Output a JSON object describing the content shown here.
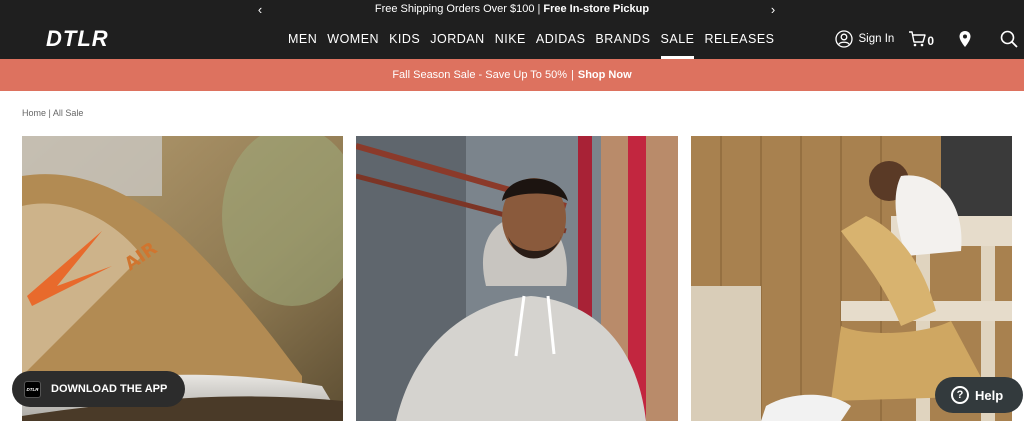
{
  "promo": {
    "text_regular": "Free Shipping Orders Over $100 | ",
    "text_bold": "Free In-store Pickup",
    "prev_glyph": "‹",
    "next_glyph": "›"
  },
  "header": {
    "logo": "DTLR",
    "nav": [
      {
        "label": "MEN"
      },
      {
        "label": "WOMEN"
      },
      {
        "label": "KIDS"
      },
      {
        "label": "JORDAN"
      },
      {
        "label": "NIKE"
      },
      {
        "label": "ADIDAS"
      },
      {
        "label": "BRANDS"
      },
      {
        "label": "SALE",
        "active": true
      },
      {
        "label": "RELEASES"
      }
    ],
    "sign_in": "Sign In",
    "cart_count": "0"
  },
  "sale_banner": {
    "text": "Fall Season Sale - Save Up To 50%",
    "separator": "|",
    "link": "Shop Now"
  },
  "breadcrumb": {
    "home": "Home",
    "separator": " | ",
    "current": "All Sale"
  },
  "app_badge": {
    "logo_text": "DTLR",
    "label": "DOWNLOAD THE APP"
  },
  "help": {
    "label": "Help"
  },
  "colors": {
    "header_bg": "#1f1f1f",
    "sale_banner_bg": "#dd725f"
  }
}
